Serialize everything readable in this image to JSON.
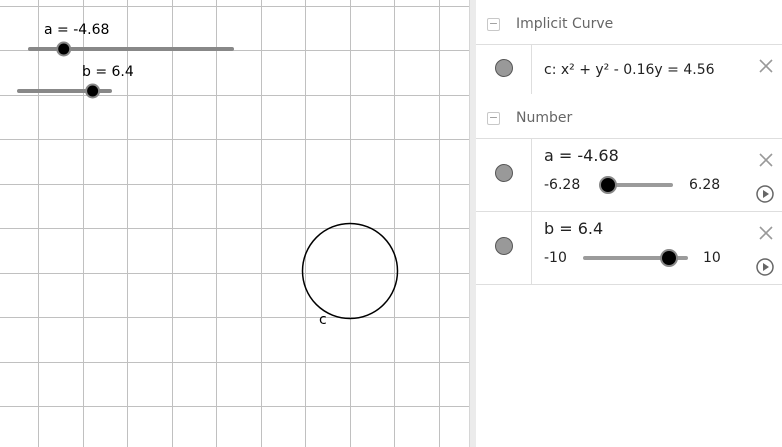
{
  "graphics": {
    "slider_a": {
      "label": "a = -4.68",
      "value": -4.68,
      "min": -6.28,
      "max": 6.28
    },
    "slider_b": {
      "label": "b = 6.4",
      "value": 6.4,
      "min": -10,
      "max": 10
    },
    "curve_label": "c"
  },
  "algebra": {
    "groups": [
      {
        "toggle": "−",
        "label": "Implicit Curve"
      },
      {
        "toggle": "−",
        "label": "Number"
      }
    ],
    "curve": {
      "definition": "c: x² + y² - 0.16y = 4.56"
    },
    "number_a": {
      "definition": "a = -4.68",
      "min": "-6.28",
      "max": "6.28",
      "value": -4.68,
      "range": [
        -6.28,
        6.28
      ]
    },
    "number_b": {
      "definition": "b = 6.4",
      "min": "-10",
      "max": "10",
      "value": 6.4,
      "range": [
        -10,
        10
      ]
    }
  },
  "colors": {
    "grid": "#c0c0c0",
    "marble_fill": "#999999",
    "slider_track": "#9b9b9b",
    "thumb": "#000000"
  }
}
